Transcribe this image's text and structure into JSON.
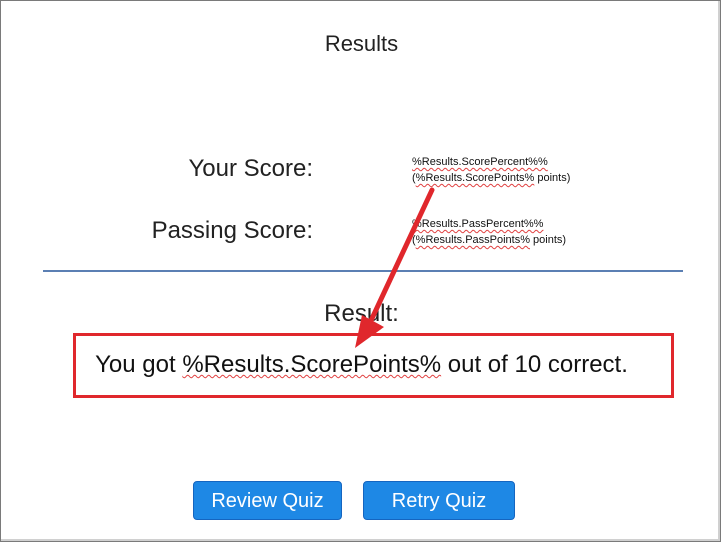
{
  "header": {
    "title": "Results"
  },
  "scores": {
    "your_score_label": "Your Score:",
    "your_score_percent": "%Results.ScorePercent%%",
    "your_score_points_open": "(",
    "your_score_points_var": "%Results.ScorePoints%",
    "your_score_points_suffix": " points)",
    "passing_score_label": "Passing Score:",
    "passing_score_percent": "%Results.PassPercent%%",
    "passing_score_points_open": "(",
    "passing_score_points_var": "%Results.PassPoints%",
    "passing_score_points_suffix": " points)"
  },
  "result": {
    "label": "Result:",
    "message_prefix": "You got ",
    "message_var": "%Results.ScorePoints%",
    "message_suffix": " out of 10 correct."
  },
  "buttons": {
    "review_label": "Review Quiz",
    "retry_label": "Retry Quiz"
  },
  "colors": {
    "button_blue": "#1e88e5",
    "highlight_red": "#e0272c",
    "divider_blue": "#5b7fb3",
    "spellcheck_red": "#e04040"
  },
  "icons": {
    "annotation": "red-arrow-icon"
  }
}
